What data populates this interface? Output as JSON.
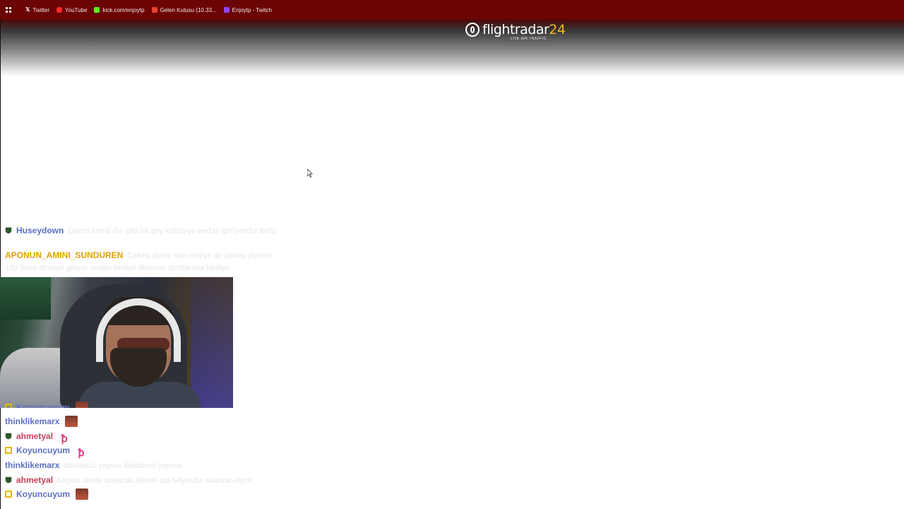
{
  "bookmarks": [
    {
      "label": "Twitter",
      "icon": "x-icon"
    },
    {
      "label": "YouTube",
      "icon": "youtube-icon"
    },
    {
      "label": "kick.com/enjoytp",
      "icon": "kick-icon"
    },
    {
      "label": "Gelen Kutusu (10.33...",
      "icon": "gmail-icon"
    },
    {
      "label": "Enjoytp - Twitch",
      "icon": "twitch-icon"
    }
  ],
  "site": {
    "logo_text": "flightradar",
    "logo_number": "24",
    "logo_sub": "LIVE AIR TRAFFIC"
  },
  "chat": {
    "top": [
      {
        "user": "Huseydown",
        "text": "Opera kendi dırı gibi bir şey kullanıyo ondan giriliyordur bello",
        "badge": "shield"
      },
      {
        "user": "APONUN_AMINI_SUNDUREN",
        "text": "Çekiliş deme son hediye de çekiliş diyince 10p falan deveye giriyor ondan hediye diyorum dostlarıma hediye",
        "badge": "none"
      }
    ],
    "bottom": [
      {
        "user": "Koyuncuyum",
        "text": "",
        "badge": "crown",
        "emote": "face"
      },
      {
        "user": "thinklikemarx",
        "text": "",
        "badge": "none",
        "emote": "face"
      },
      {
        "user": "ahmetyal",
        "text": "",
        "badge": "shield",
        "emote": "pink"
      },
      {
        "user": "Koyuncuyum",
        "text": "",
        "badge": "crown",
        "emote": "pink"
      },
      {
        "user": "thinklikemarx",
        "text": "dördüncü yayına dördüncü yayına",
        "badge": "none"
      },
      {
        "user": "ahmetyal",
        "text": "başımı derde sokacak Ahmet abi biliyordur okanlan diyor",
        "badge": "shield"
      },
      {
        "user": "Koyuncuyum",
        "text": "",
        "badge": "crown",
        "emote": "face"
      }
    ]
  },
  "colors": {
    "bookmark_bar": "#6b0404",
    "username_blue": "#5b6ec4",
    "username_orange": "#e0a000",
    "username_red": "#c8405a"
  }
}
